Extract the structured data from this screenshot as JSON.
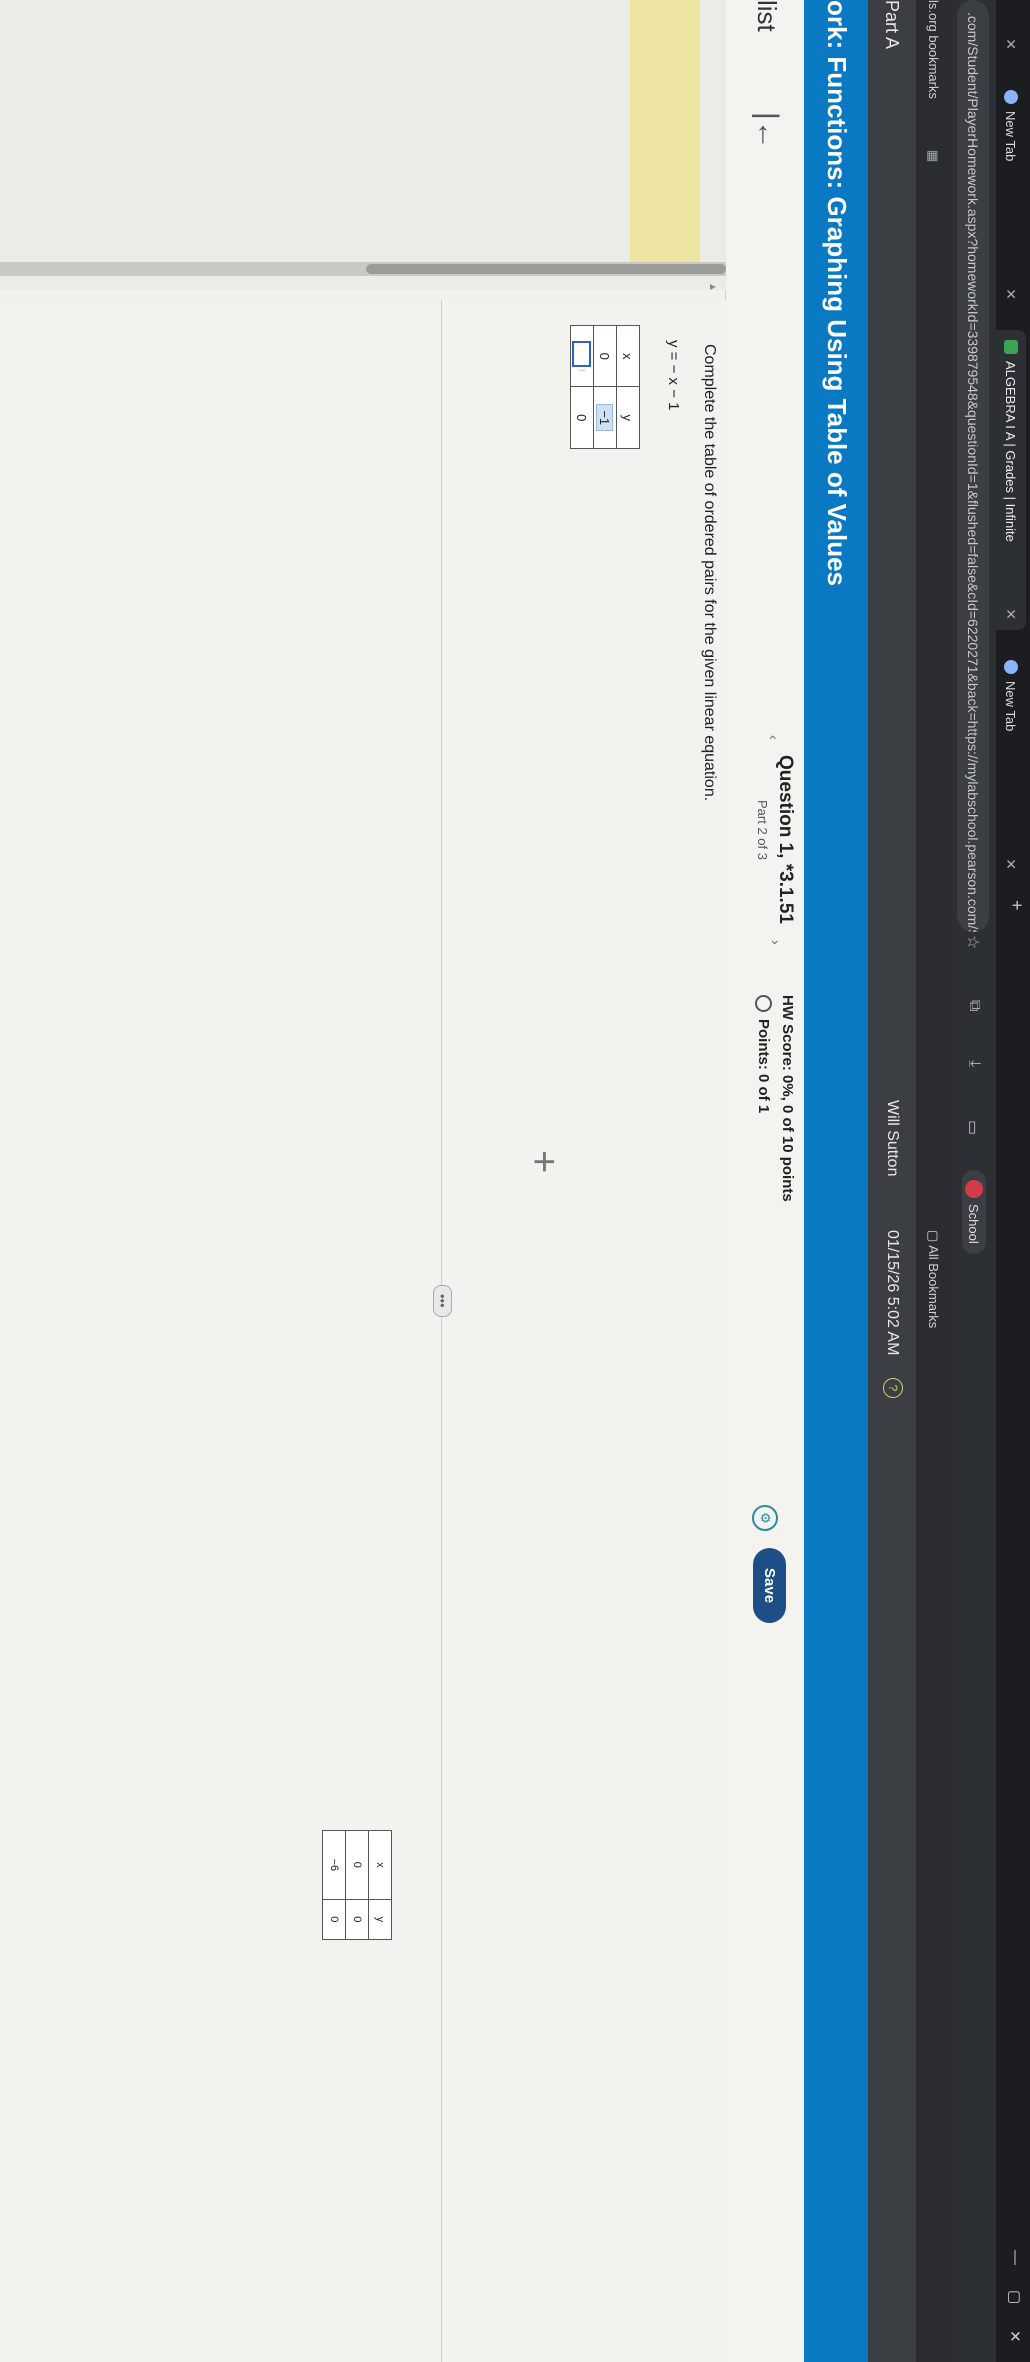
{
  "browser": {
    "tabs": [
      {
        "label": "New Tab"
      },
      {
        "label": "ALGEBRA I A | Grades | Infinite"
      },
      {
        "label": "New Tab"
      }
    ],
    "new_tab_symbol": "+",
    "url": ".com/Student/PlayerHomework.aspx?homeworkId=339879548&questionId=1&flushed=false&cId=6220271&back=https://mylabschool.pearson.com/Student/DoHomework...",
    "bookmarks": {
      "left_label": "ls.org bookmarks",
      "school": "School",
      "all_bookmarks": "All Bookmarks"
    }
  },
  "header": {
    "part": "Part A",
    "user": "Will Sutton",
    "datetime": "01/15/26 5:02 AM"
  },
  "homework": {
    "title": "ork: Functions: Graphing Using Table of Values"
  },
  "question": {
    "list_label": "list",
    "title": "Question 1, *3.1.51",
    "part": "Part 2 of 3",
    "hw_score": "HW Score: 0%, 0 of 10 points",
    "points": "Points: 0 of 1",
    "save_label": "Save",
    "prev_symbol": "‹",
    "next_symbol": "›",
    "instruction": "Complete the table of ordered pairs for the given linear equation.",
    "equation": "y = − x − 1",
    "table": {
      "headers": [
        "x",
        "y"
      ],
      "rows": [
        [
          "0",
          "−1"
        ],
        [
          "",
          "0"
        ]
      ]
    },
    "side_table": {
      "headers": [
        "x",
        "y"
      ],
      "rows": [
        [
          "0",
          "0"
        ],
        [
          "−6",
          "0"
        ]
      ]
    },
    "more_symbol": "•••",
    "cursor_symbol": "+"
  },
  "colors": {
    "blue_bar": "#0a79c4",
    "save_button": "#1d4f86",
    "answer_box": "#2d63c8"
  }
}
